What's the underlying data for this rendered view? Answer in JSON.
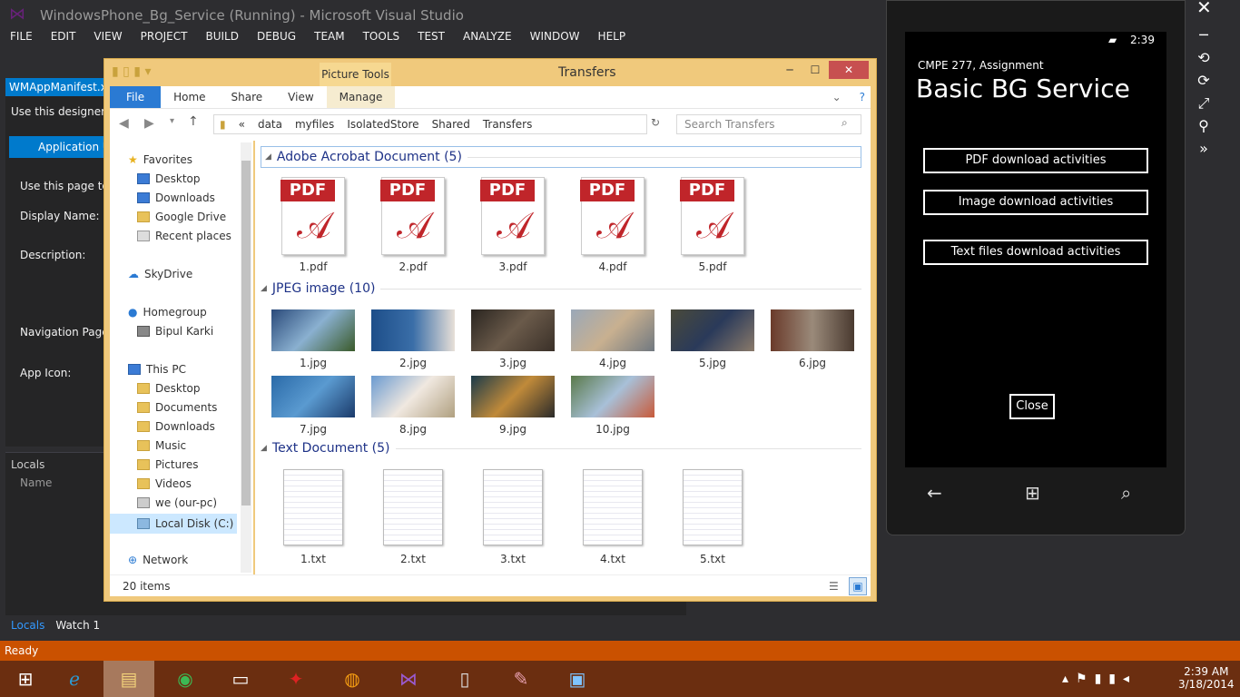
{
  "vs": {
    "title": "WindowsPhone_Bg_Service (Running) - Microsoft Visual Studio",
    "menu": [
      "FILE",
      "EDIT",
      "VIEW",
      "PROJECT",
      "BUILD",
      "DEBUG",
      "TEAM",
      "TOOLS",
      "TEST",
      "ANALYZE",
      "WINDOW",
      "HELP"
    ],
    "manifest_tab": "WMAppManifest.xml",
    "designer_hint": "Use this designer to",
    "app_ui_tab": "Application UI",
    "page_hint": "Use this page to s",
    "display_name": "Display Name:",
    "description": "Description:",
    "navigation_page": "Navigation Page:",
    "app_icon": "App Icon:",
    "locals_title": "Locals",
    "locals_col": "Name",
    "bottom_tabs": [
      "Locals",
      "Watch 1"
    ],
    "status": "Ready"
  },
  "explorer": {
    "title": "Transfers",
    "picture_tools": "Picture Tools",
    "ribbon": [
      "File",
      "Home",
      "Share",
      "View",
      "Manage"
    ],
    "address": [
      "data",
      "myfiles",
      "IsolatedStore",
      "Shared",
      "Transfers"
    ],
    "address_prefix": "«",
    "search_placeholder": "Search Transfers",
    "nav": {
      "favorites": "Favorites",
      "fav_items": [
        "Desktop",
        "Downloads",
        "Google Drive",
        "Recent places"
      ],
      "skydrive": "SkyDrive",
      "homegroup": "Homegroup",
      "home_user": "Bipul Karki",
      "this_pc": "This PC",
      "pc_items": [
        "Desktop",
        "Documents",
        "Downloads",
        "Music",
        "Pictures",
        "Videos",
        "we (our-pc)",
        "Local Disk (C:)"
      ],
      "network": "Network"
    },
    "groups": {
      "pdf": "Adobe Acrobat Document (5)",
      "jpeg": "JPEG image (10)",
      "txt": "Text Document (5)"
    },
    "pdf_label": "PDF",
    "pdf_files": [
      "1.pdf",
      "2.pdf",
      "3.pdf",
      "4.pdf",
      "5.pdf"
    ],
    "jpg_files": [
      "1.jpg",
      "2.jpg",
      "3.jpg",
      "4.jpg",
      "5.jpg",
      "6.jpg",
      "7.jpg",
      "8.jpg",
      "9.jpg",
      "10.jpg"
    ],
    "txt_files": [
      "1.txt",
      "2.txt",
      "3.txt",
      "4.txt",
      "5.txt"
    ],
    "item_count": "20 items"
  },
  "phone": {
    "time": "2:39",
    "subtitle": "CMPE 277, Assignment",
    "title": "Basic BG Service",
    "buttons": [
      "PDF download activities",
      "Image download activities",
      "Text files download activities"
    ],
    "close": "Close"
  },
  "taskbar": {
    "time": "2:39 AM",
    "date": "3/18/2014"
  },
  "colors": {
    "vs_accent": "#007acc",
    "status_bar": "#ca5100",
    "explorer_frame": "#f0c97c",
    "pdf_red": "#c0252a"
  }
}
